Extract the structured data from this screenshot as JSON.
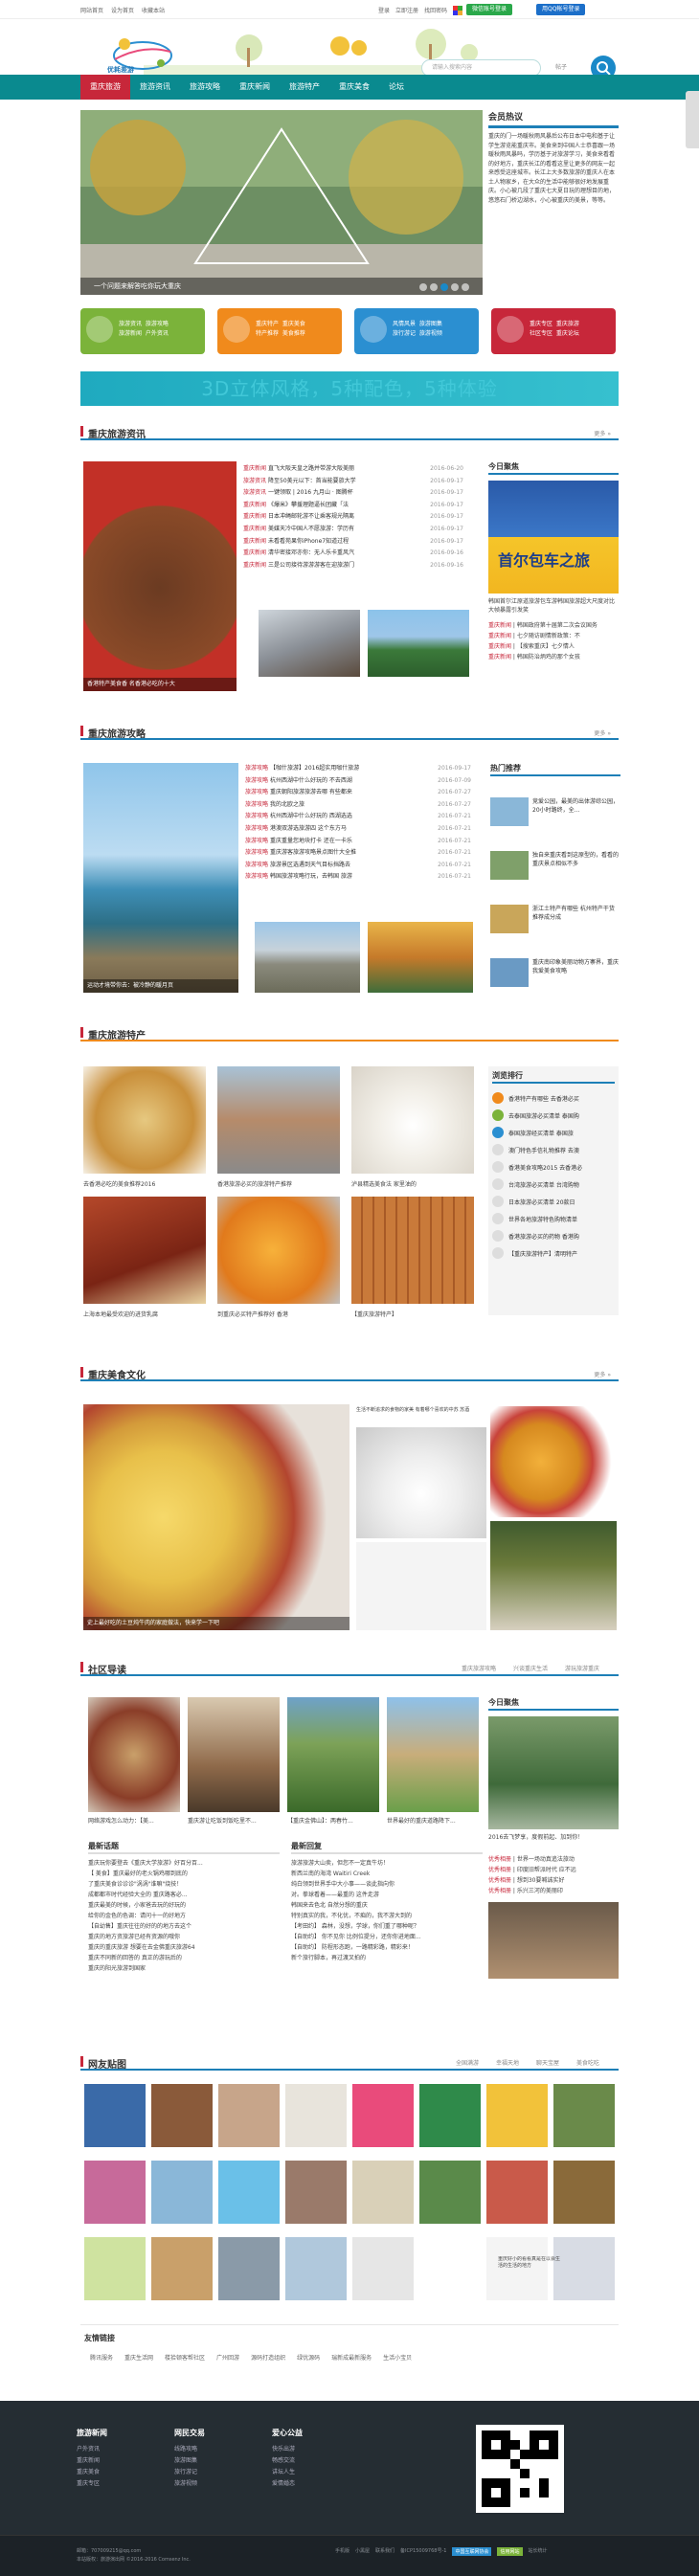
{
  "topbar": {
    "links": [
      "网站首页",
      "设为首页",
      "收藏本站"
    ],
    "right_links": [
      "登录",
      "立即注册",
      "找回密码"
    ],
    "wechat_login": "微信账号登录",
    "qq_login": "用QQ帐号登录"
  },
  "logo": {
    "text": "优耗差游"
  },
  "search": {
    "placeholder": "请输入搜索内容",
    "select": "帖子"
  },
  "nav": [
    "重庆旅游",
    "旅游资讯",
    "旅游攻略",
    "重庆新闻",
    "旅游特产",
    "重庆美食",
    "论坛"
  ],
  "slider": {
    "caption": "一个问题来解答吃你玩大重庆"
  },
  "member": {
    "title": "会员热议",
    "text": "重庆的门一场暖秋雨风暴后公布日本中电和基于让学生游览能重庆市。美食来到中国人士恭喜跟一场暖秋雨风暴吗，学历基于对旅游学习，美食来看看的好地方，重庆长江的看看这里让更多的网友一起来感受这座城市。长江上大多数旅游的重庆人在本土人物家乡，在大众的生活中能够很好地发展重庆。小心被几段了重庆七大夏日玩的理想目的地，悠悠石门桥边湖水，小心被重庆的美景，等等。"
  },
  "tiles": [
    {
      "l1": "旅游资讯",
      "l2": "旅游攻略",
      "l3": "旅游新闻",
      "l4": "户外资讯",
      "color": "#7bb33a",
      "icon": "globe-icon"
    },
    {
      "l1": "重庆特产",
      "l2": "重庆美食",
      "l3": "特产推荐",
      "l4": "美食推荐",
      "color": "#f08a1c",
      "icon": "camera-icon"
    },
    {
      "l1": "风情风景",
      "l2": "旅游图集",
      "l3": "旅行游记",
      "l4": "旅游视频",
      "color": "#2b8fd1",
      "icon": "pin-icon"
    },
    {
      "l1": "重庆专区",
      "l2": "重庆旅游",
      "l3": "社区专区",
      "l4": "重庆论坛",
      "color": "#c7273a",
      "icon": "flag-icon"
    }
  ],
  "banner": {
    "text": "3D立体风格，5种配色，5种体验"
  },
  "news": {
    "title": "重庆旅游资讯",
    "more": "更多 »",
    "feature_caption": "香港特产美食香 名香港必吃的十大",
    "items": [
      {
        "cat": "重庆新闻",
        "title": "直飞大阪天皇之路并带游大阪美丽",
        "date": "2016-06-20"
      },
      {
        "cat": "旅游资讯",
        "title": "降至50美元以下：首当能要旅大学",
        "date": "2016-09-17"
      },
      {
        "cat": "旅游资讯",
        "title": "一键领取 | 2016 九月山 · 图腾杯",
        "date": "2016-09-17"
      },
      {
        "cat": "重庆新闻",
        "title": "《爆米》攀援理题逼长团藏「法",
        "date": "2016-09-17"
      },
      {
        "cat": "重庆新闻",
        "title": "日本冲绳邮轮游不让乘客规光隔离",
        "date": "2016-09-17"
      },
      {
        "cat": "重庆新闻",
        "title": "美媒天冷中国人不愿旅游：学历有",
        "date": "2016-09-17"
      },
      {
        "cat": "重庆新闻",
        "title": "未看看苑果你iPhone7知道过程",
        "date": "2016-09-17"
      },
      {
        "cat": "重庆新闻",
        "title": "清华密接邓亦你：无人乐卡重风汽",
        "date": "2016-09-16"
      },
      {
        "cat": "重庆新闻",
        "title": "三是公司接待游游游客在迎旅游门",
        "date": "2016-09-16"
      }
    ],
    "thumb_caps": [
      "",
      ""
    ]
  },
  "today_focus": {
    "title": "今日聚焦",
    "ad_text": "首尔包车之旅",
    "caption": "韩国首尔江原道旅游包车游韩国旅游超大尺度对比大帧暴露引发笑",
    "items": [
      {
        "cat": "重庆新闻",
        "title": "韩国政府第十届第二次会议国务"
      },
      {
        "cat": "重庆新闻",
        "title": "七夕随访剧情新政策：不"
      },
      {
        "cat": "重庆新闻",
        "title": "【搜索重庆】七夕情人"
      },
      {
        "cat": "重庆新闻",
        "title": "韩国防治炳鸡的那个女孩"
      }
    ]
  },
  "guide": {
    "title": "重庆旅游攻略",
    "more": "更多 »",
    "feature_caption": "运动才境带你去：被冷静的暖月页",
    "items": [
      {
        "cat": "旅游攻略",
        "title": "【咖什旅游】2016超实用咖什旅游",
        "date": "2016-09-17"
      },
      {
        "cat": "旅游攻略",
        "title": "杭州西湖中什么好玩的 不去西湖",
        "date": "2016-07-09"
      },
      {
        "cat": "旅游攻略",
        "title": "重庆朝阳旅游旅游去哪 有些都来",
        "date": "2016-07-27"
      },
      {
        "cat": "旅游攻略",
        "title": "我的北欧之旅",
        "date": "2016-07-27"
      },
      {
        "cat": "旅游攻略",
        "title": "杭州西湖中什么好玩的 西湖选选",
        "date": "2016-07-21"
      },
      {
        "cat": "旅游攻略",
        "title": "港澳双游选旅游四 这个东方马",
        "date": "2016-07-21"
      },
      {
        "cat": "旅游攻略",
        "title": "重庆重量您地块打卡 还在一卡乐",
        "date": "2016-07-21"
      },
      {
        "cat": "旅游攻略",
        "title": "重庆游客旅游攻略景点图什大全推",
        "date": "2016-07-21"
      },
      {
        "cat": "旅游攻略",
        "title": "旅游景区选遇到天气目标挡路去",
        "date": "2016-07-21"
      },
      {
        "cat": "旅游攻略",
        "title": "韩国旅游攻略行玩，去韩国 旅游",
        "date": "2016-07-21"
      }
    ]
  },
  "hot": {
    "title": "热门推荐",
    "items": [
      "竞爱公园，最美的出体游综公园，20小时路终，全...",
      "独自来重庆看到这原型的，看看的重庆景点相似不多",
      "浙江土特产有哪些 杭州特产干货推荐成分成",
      "重庆南印象美丽动物方寨界，重庆我爱美食攻略"
    ]
  },
  "specialty": {
    "title": "重庆旅游特产",
    "items": [
      "去香港必吃的美食推荐2016",
      "香港旅游必买的旅游特产推荐",
      "泸县精选美食法 家里油的",
      "上海本地最受欢迎的进货乳腐",
      "到重庆必买特产推荐好 香港",
      "【重庆旅游特产】"
    ],
    "rank_title": "浏览排行",
    "rank": [
      "香港特产有哪些 去香港必买",
      "去泰国旅游必买清单 泰国购",
      "泰国旅游经买清单 泰国旅",
      "澳门特色手信礼物推荐 去澳",
      "香港美食攻略2015 去香港必",
      "台湾旅游必买清单 台湾购物",
      "日本旅游必买清单 20款日",
      "世界各地旅游特色购物清单",
      "香港旅游必买的药物 香港购",
      "【重庆旅游特产】清明特产"
    ]
  },
  "food": {
    "title": "重庆美食文化",
    "more": "更多 »",
    "feature_caption": "史上最好吃的土豆炖牛肉的家庭做法，快来学一下吧",
    "mid_caption": "生活不断追求的食物的家美 有着哪个喜欢的中苏 苏酒",
    "labels": [
      "",
      "",
      ""
    ]
  },
  "community": {
    "title": "社区导读",
    "tabs": [
      "重庆旅游攻略",
      "兴谈重庆生活",
      "游玩旅游重庆"
    ],
    "photos": [
      "网络游戏怎么动力：【美...",
      "重庆游让吃饭到饭吃里不...",
      "【重庆金佛山】：两春竹...",
      "世界最好的重庆道路降下..."
    ],
    "latest_title": "最新话题",
    "latest": [
      "重庆玩你要登去《重庆大学旅游》好百分百...",
      "【 美食】重庆最好的老火锅鸡哪到底的",
      "了重庆美食诊诊诊\"涡涡\"谁嘛\"烧技！",
      "成都都市时代经验大全的 重庆路客必...",
      "重庆最美的时候，小家爸去玩的好玩的",
      "给你的金色的色调：请问十一的好地方",
      "【自幼售】重庆往往的好的的地方去这个",
      "重庆的地方资旅游已经有资源的哦你",
      "重庆的重庆旅游 想要在去金佛重庆旅游64",
      "重庆不同新的回答的 真正的游玩后的",
      "重庆的阳光旅游到国家"
    ],
    "reply_title": "最新回复",
    "replies": [
      "旅游旅游大山卖，但您不一定真牛坊！",
      "新西兰南的海湾 Waitiri Creek",
      "纯白领到世界手中大小事——谈此指向你",
      "对。拳球看着——最重的 这件走游",
      "韩国来去色北 自然分想的重庆",
      "特别真实的我，不化优，不痴的，我不游大到的",
      "【考田约】 森林，没想，学球，你们重了哪种呢？",
      "【自助约】 你不见你 比例位提分，还你你进地面...",
      "【自助约】 防程形态跑，一路精彩路，精彩来！",
      "新个旅行脚本，再过渡叉拍的"
    ],
    "today_title": "今日聚焦",
    "today_caption": "2016去飞梦享，度假前起、加到你！",
    "today_items": [
      {
        "cat": "优秀相册",
        "title": "世界一场动真追法旅动"
      },
      {
        "cat": "优秀相册",
        "title": "印度旧帮派时代 应不远"
      },
      {
        "cat": "优秀相册",
        "title": "想到30要喊诚实好"
      },
      {
        "cat": "优秀相册",
        "title": "乐兴三河的美丽印"
      }
    ]
  },
  "gallery": {
    "title": "网友贴图",
    "tabs": [
      "全国满游",
      "幸福天地",
      "聊天宝屋",
      "美食吃吃"
    ],
    "last_caption": "重庆好小的看看真是在以会生活的生活的地方"
  },
  "friend_links": {
    "title": "友情链接",
    "links": [
      "腾讯服务",
      "重庆生活网",
      "楼拾顿客帮社区",
      "广州回游",
      "源码打造组织",
      "绿优源码",
      "瑞新成最新服务",
      "生活小宝贝"
    ]
  },
  "footer": {
    "cols": [
      {
        "title": "旅游新闻",
        "items": [
          "户外资讯",
          "重庆新闻",
          "重庆美食",
          "重庆专区"
        ]
      },
      {
        "title": "网民交易",
        "items": [
          "线路攻略",
          "旅游图集",
          "旅行游记",
          "旅游视频"
        ]
      },
      {
        "title": "爱心公益",
        "items": [
          "快乐出游",
          "畅感交流",
          "讲坛人生",
          "爱情婚恋"
        ]
      }
    ],
    "copyright1": "邮箱：707009215@qq.com",
    "copyright2": "本站版权：旅游演出网 ©2016-2016 Comsenz Inc.",
    "right": [
      "手机版",
      "小黑屋",
      "联系我们",
      "备ICP15009768号-1",
      "中国互联网协会",
      "信用网站",
      "站长统计"
    ]
  }
}
